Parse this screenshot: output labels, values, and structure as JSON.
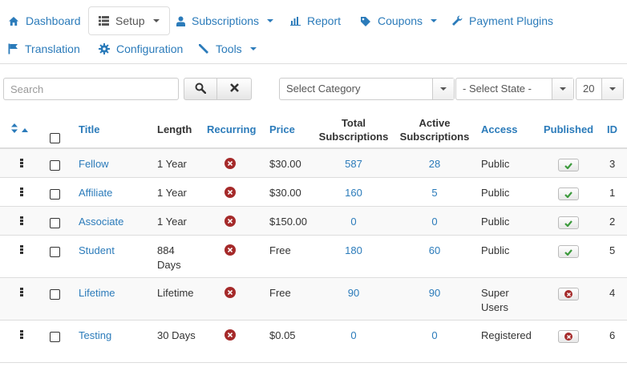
{
  "nav": {
    "dashboard": "Dashboard",
    "setup": "Setup",
    "subscriptions": "Subscriptions",
    "report": "Report",
    "coupons": "Coupons",
    "payment_plugins": "Payment Plugins",
    "translation": "Translation",
    "configuration": "Configuration",
    "tools": "Tools"
  },
  "filters": {
    "search_placeholder": "Search",
    "category_select": "Select Category",
    "state_select": "- Select State -",
    "limit_select": "20"
  },
  "table": {
    "headers": {
      "title": "Title",
      "length": "Length",
      "recurring": "Recurring",
      "price": "Price",
      "total_subscriptions": "Total Subscriptions",
      "active_subscriptions": "Active Subscriptions",
      "access": "Access",
      "published": "Published",
      "id": "ID"
    },
    "rows": [
      {
        "title": "Fellow",
        "length": "1 Year",
        "recurring": false,
        "price": "$30.00",
        "total": "587",
        "active": "28",
        "access": "Public",
        "published": true,
        "id": "3"
      },
      {
        "title": "Affiliate",
        "length": "1 Year",
        "recurring": false,
        "price": "$30.00",
        "total": "160",
        "active": "5",
        "access": "Public",
        "published": true,
        "id": "1"
      },
      {
        "title": "Associate",
        "length": "1 Year",
        "recurring": false,
        "price": "$150.00",
        "total": "0",
        "active": "0",
        "access": "Public",
        "published": true,
        "id": "2"
      },
      {
        "title": "Student",
        "length": "884 Days",
        "recurring": false,
        "price": "Free",
        "total": "180",
        "active": "60",
        "access": "Public",
        "published": true,
        "id": "5"
      },
      {
        "title": "Lifetime",
        "length": "Lifetime",
        "recurring": false,
        "price": "Free",
        "total": "90",
        "active": "90",
        "access": "Super Users",
        "published": false,
        "id": "4"
      },
      {
        "title": "Testing",
        "length": "30 Days",
        "recurring": false,
        "price": "$0.05",
        "total": "0",
        "active": "0",
        "access": "Registered",
        "published": false,
        "id": "6"
      }
    ]
  },
  "colors": {
    "link": "#2b7bba",
    "published_check": "#3c9a3c",
    "unpublished_x": "#a52a2a",
    "recurring_x": "#a52a2a"
  }
}
